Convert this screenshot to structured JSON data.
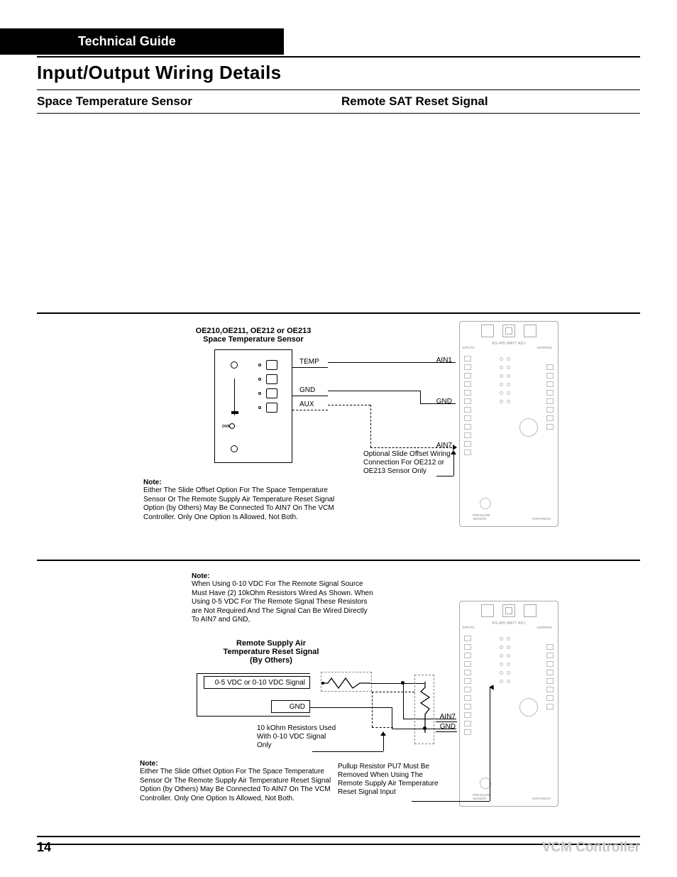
{
  "header": {
    "tab": "Technical Guide",
    "title": "Input/Output Wiring Details",
    "section_left": "Space Temperature Sensor",
    "section_right": "Remote SAT Reset Signal"
  },
  "figure1": {
    "title_line1": "OE210,OE211, OE212 or OE213",
    "title_line2": "Space Temperature Sensor",
    "pins": {
      "temp": "TEMP",
      "gnd": "GND",
      "aux": "AUX"
    },
    "ovr": "OVR",
    "terms": {
      "ain1": "AIN1",
      "gnd": "GND",
      "ain7": "AIN7"
    },
    "callout": "Optional Slide Offset Wiring Connection For OE212 or OE213 Sensor Only",
    "note_label": "Note:",
    "note": "Either The Slide Offset Option For The Space Temperature Sensor Or The Remote Supply Air Temperature Reset Signal Option (by Others) May Be Connected To AIN7 On The VCM Controller. Only One Option Is Allowed, Not Both."
  },
  "figure2": {
    "note1_label": "Note:",
    "note1": "When Using 0-10 VDC For The Remote Signal Source Must Have (2) 10kOhm Resistors Wired As Shown. When Using  0-5 VDC For The Remote Signal These Resistors are Not Required And The Signal Can Be Wired Directly To AIN7 and GND,",
    "title_line1": "Remote Supply Air",
    "title_line2": "Temperature Reset Signal",
    "title_line3": "(By Others)",
    "sig_label": "0-5 VDC or 0-10 VDC Signal",
    "gnd_label": "GND",
    "resistor_callout": "10 kOhm Resistors Used With 0-10 VDC Signal Only",
    "terms": {
      "ain7": "AIN7",
      "gnd": "GND"
    },
    "pullup_callout": "Pullup Resistor PU7 Must Be Removed When Using The Remote Supply Air Temperature Reset Signal Input",
    "note2_label": "Note:",
    "note2": "Either The Slide Offset Option For The Space Temperature Sensor Or The Remote Supply Air Temperature Reset Signal Option (by Others) May Be Connected To AIN7 On The VCM Controller. Only One Option Is Allowed, Not Both."
  },
  "footer": {
    "page": "14",
    "doc": "VCM Controller"
  }
}
